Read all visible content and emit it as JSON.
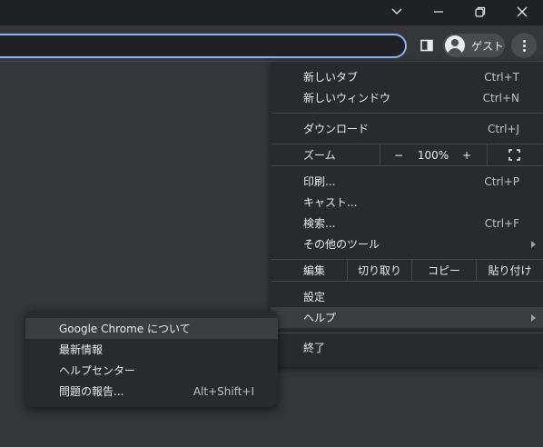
{
  "titlebar": {
    "controls": [
      "collapse",
      "minimize",
      "restore",
      "close"
    ]
  },
  "toolbar": {
    "profile_label": "ゲスト"
  },
  "menu": {
    "new_tab": {
      "label": "新しいタブ",
      "shortcut": "Ctrl+T"
    },
    "new_window": {
      "label": "新しいウィンドウ",
      "shortcut": "Ctrl+N"
    },
    "downloads": {
      "label": "ダウンロード",
      "shortcut": "Ctrl+J"
    },
    "zoom": {
      "label": "ズーム",
      "minus": "−",
      "level": "100%",
      "plus": "+"
    },
    "print": {
      "label": "印刷...",
      "shortcut": "Ctrl+P"
    },
    "cast": {
      "label": "キャスト..."
    },
    "find": {
      "label": "検索...",
      "shortcut": "Ctrl+F"
    },
    "more_tools": {
      "label": "その他のツール"
    },
    "edit": {
      "label": "編集",
      "cut": "切り取り",
      "copy": "コピー",
      "paste": "貼り付け"
    },
    "settings": {
      "label": "設定"
    },
    "help": {
      "label": "ヘルプ"
    },
    "exit": {
      "label": "終了"
    }
  },
  "help_submenu": {
    "about": {
      "label": "Google Chrome について"
    },
    "whats_new": {
      "label": "最新情報"
    },
    "help_center": {
      "label": "ヘルプセンター"
    },
    "report": {
      "label": "問題の報告...",
      "shortcut": "Alt+Shift+I"
    }
  },
  "colors": {
    "titlebar": "#202124",
    "toolbar": "#35363a",
    "menu_bg": "#292a2d",
    "highlight": "#3c3d41",
    "focus_ring": "#8ab4f8",
    "text": "#e8eaed"
  }
}
